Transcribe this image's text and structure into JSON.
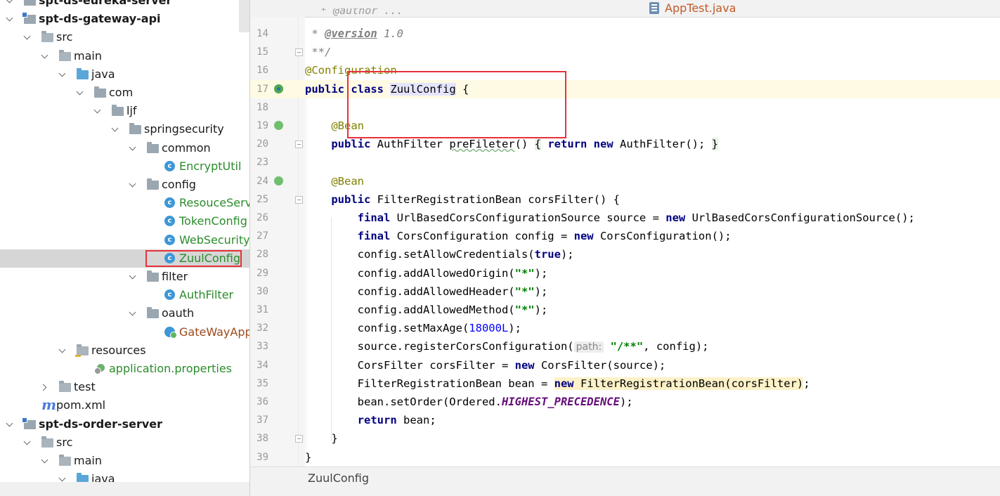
{
  "project_tree": {
    "rows": [
      {
        "label": "spt-ds-eureka-server",
        "depth": 0,
        "expanded": true,
        "icon": "module-icon",
        "style": "bold"
      },
      {
        "label": "spt-ds-gateway-api",
        "depth": 0,
        "expanded": true,
        "icon": "module-icon",
        "style": "bold"
      },
      {
        "label": "src",
        "depth": 1,
        "expanded": true,
        "icon": "folder-icon",
        "style": "plain"
      },
      {
        "label": "main",
        "depth": 2,
        "expanded": true,
        "icon": "folder-icon",
        "style": "plain"
      },
      {
        "label": "java",
        "depth": 3,
        "expanded": true,
        "icon": "source-folder-icon",
        "style": "plain"
      },
      {
        "label": "com",
        "depth": 4,
        "expanded": true,
        "icon": "package-icon",
        "style": "plain"
      },
      {
        "label": "ljf",
        "depth": 5,
        "expanded": true,
        "icon": "package-icon",
        "style": "plain"
      },
      {
        "label": "springsecurity",
        "depth": 6,
        "expanded": true,
        "icon": "package-icon",
        "style": "plain"
      },
      {
        "label": "common",
        "depth": 7,
        "expanded": true,
        "icon": "package-icon",
        "style": "plain"
      },
      {
        "label": "EncryptUtil",
        "depth": 8,
        "icon": "class-icon",
        "style": "green"
      },
      {
        "label": "config",
        "depth": 7,
        "expanded": true,
        "icon": "package-icon",
        "style": "plain"
      },
      {
        "label": "ResouceServer",
        "depth": 8,
        "icon": "class-icon",
        "style": "green"
      },
      {
        "label": "TokenConfig",
        "depth": 8,
        "icon": "class-icon",
        "style": "green"
      },
      {
        "label": "WebSecurityC",
        "depth": 8,
        "icon": "class-icon",
        "style": "green"
      },
      {
        "label": "ZuulConfig",
        "depth": 8,
        "icon": "class-icon",
        "style": "green",
        "selected": true
      },
      {
        "label": "filter",
        "depth": 7,
        "expanded": true,
        "icon": "package-icon",
        "style": "plain"
      },
      {
        "label": "AuthFilter",
        "depth": 8,
        "icon": "class-icon",
        "style": "green"
      },
      {
        "label": "oauth",
        "depth": 7,
        "expanded": true,
        "icon": "package-icon",
        "style": "plain"
      },
      {
        "label": "GateWayApp",
        "depth": 8,
        "icon": "spring-app-icon",
        "style": "brown"
      },
      {
        "label": "resources",
        "depth": 3,
        "expanded": true,
        "icon": "resources-folder-icon",
        "style": "plain"
      },
      {
        "label": "application.properties",
        "depth": 4,
        "icon": "properties-icon",
        "style": "green"
      },
      {
        "label": "test",
        "depth": 2,
        "expanded": false,
        "icon": "folder-icon",
        "style": "plain"
      },
      {
        "label": "pom.xml",
        "depth": 1,
        "icon": "maven-icon",
        "style": "plain"
      },
      {
        "label": "spt-ds-order-server",
        "depth": 0,
        "expanded": true,
        "icon": "module-icon",
        "style": "bold"
      },
      {
        "label": "src",
        "depth": 1,
        "expanded": true,
        "icon": "folder-icon",
        "style": "plain"
      },
      {
        "label": "main",
        "depth": 2,
        "expanded": true,
        "icon": "folder-icon",
        "style": "plain"
      },
      {
        "label": "java",
        "depth": 3,
        "expanded": true,
        "icon": "source-folder-icon",
        "style": "plain"
      }
    ]
  },
  "editor": {
    "tab_title": "AppTest.java",
    "status_breadcrumb": "ZuulConfig",
    "top_partial_text": "* @author ...",
    "lines": [
      {
        "n": "14",
        "tokens": [
          {
            "t": " * ",
            "c": "doc"
          },
          {
            "t": "@version",
            "c": "doctag"
          },
          {
            "t": " 1.0",
            "c": "doc"
          }
        ]
      },
      {
        "n": "15",
        "fold": true,
        "tokens": [
          {
            "t": " **/",
            "c": "doc"
          }
        ]
      },
      {
        "n": "16",
        "tokens": [
          {
            "t": "@Configuration",
            "c": "ann"
          }
        ]
      },
      {
        "n": "17",
        "current": true,
        "gutter": "impl",
        "tokens": [
          {
            "t": "public",
            "c": "kw"
          },
          {
            "t": " "
          },
          {
            "t": "class",
            "c": "kw"
          },
          {
            "t": " "
          },
          {
            "t": "ZuulConfig",
            "c": "sel"
          },
          {
            "t": " {"
          }
        ]
      },
      {
        "n": "18",
        "tokens": []
      },
      {
        "n": "19",
        "gutter": "bean",
        "tokens": [
          {
            "t": "    "
          },
          {
            "t": "@Bean",
            "c": "ann"
          }
        ]
      },
      {
        "n": "20",
        "fold": true,
        "tokens": [
          {
            "t": "    "
          },
          {
            "t": "public",
            "c": "kw"
          },
          {
            "t": " AuthFilter "
          },
          {
            "t": "preFileter",
            "c": "wavy"
          },
          {
            "t": "() "
          },
          {
            "t": "{",
            "c": "brace"
          },
          {
            "t": " "
          },
          {
            "t": "return",
            "c": "kw"
          },
          {
            "t": " "
          },
          {
            "t": "new",
            "c": "kw"
          },
          {
            "t": " AuthFilter(); "
          },
          {
            "t": "}",
            "c": "brace"
          }
        ]
      },
      {
        "n": "23",
        "tokens": []
      },
      {
        "n": "24",
        "gutter": "bean",
        "tokens": [
          {
            "t": "    "
          },
          {
            "t": "@Bean",
            "c": "ann"
          }
        ]
      },
      {
        "n": "25",
        "fold": true,
        "tokens": [
          {
            "t": "    "
          },
          {
            "t": "public",
            "c": "kw"
          },
          {
            "t": " FilterRegistrationBean corsFilter() {"
          }
        ]
      },
      {
        "n": "26",
        "tokens": [
          {
            "t": "        "
          },
          {
            "t": "final",
            "c": "kw"
          },
          {
            "t": " UrlBasedCorsConfigurationSource source = "
          },
          {
            "t": "new",
            "c": "kw"
          },
          {
            "t": " UrlBasedCorsConfigurationSource();"
          }
        ]
      },
      {
        "n": "27",
        "tokens": [
          {
            "t": "        "
          },
          {
            "t": "final",
            "c": "kw"
          },
          {
            "t": " CorsConfiguration config = "
          },
          {
            "t": "new",
            "c": "kw"
          },
          {
            "t": " CorsConfiguration();"
          }
        ]
      },
      {
        "n": "28",
        "tokens": [
          {
            "t": "        config.setAllowCredentials("
          },
          {
            "t": "true",
            "c": "kw"
          },
          {
            "t": ");"
          }
        ]
      },
      {
        "n": "29",
        "tokens": [
          {
            "t": "        config.addAllowedOrigin("
          },
          {
            "t": "\"*\"",
            "c": "str"
          },
          {
            "t": ");"
          }
        ]
      },
      {
        "n": "30",
        "tokens": [
          {
            "t": "        config.addAllowedHeader("
          },
          {
            "t": "\"*\"",
            "c": "str"
          },
          {
            "t": ");"
          }
        ]
      },
      {
        "n": "31",
        "tokens": [
          {
            "t": "        config.addAllowedMethod("
          },
          {
            "t": "\"*\"",
            "c": "str"
          },
          {
            "t": ");"
          }
        ]
      },
      {
        "n": "32",
        "tokens": [
          {
            "t": "        config.setMaxAge("
          },
          {
            "t": "18000L",
            "c": "num"
          },
          {
            "t": ");"
          }
        ]
      },
      {
        "n": "33",
        "tokens": [
          {
            "t": "        source.registerCorsConfiguration("
          },
          {
            "t": "path:",
            "c": "hint"
          },
          {
            "t": " "
          },
          {
            "t": "\"/**\"",
            "c": "str"
          },
          {
            "t": ", config);"
          }
        ]
      },
      {
        "n": "34",
        "tokens": [
          {
            "t": "        CorsFilter corsFilter = "
          },
          {
            "t": "new",
            "c": "kw"
          },
          {
            "t": " CorsFilter(source);"
          }
        ]
      },
      {
        "n": "35",
        "tokens": [
          {
            "t": "        FilterRegistrationBean bean = "
          },
          {
            "t": "new",
            "c": "kw hl"
          },
          {
            "t": " FilterRegistrationBean(corsFilter)",
            "c": "hl"
          },
          {
            "t": ";"
          }
        ]
      },
      {
        "n": "36",
        "tokens": [
          {
            "t": "        bean.setOrder(Ordered."
          },
          {
            "t": "HIGHEST_PRECEDENCE",
            "c": "const"
          },
          {
            "t": ");"
          }
        ]
      },
      {
        "n": "37",
        "tokens": [
          {
            "t": "        "
          },
          {
            "t": "return",
            "c": "kw"
          },
          {
            "t": " bean;"
          }
        ]
      },
      {
        "n": "38",
        "fold": true,
        "tokens": [
          {
            "t": "    }"
          }
        ]
      },
      {
        "n": "39",
        "tokens": [
          {
            "t": "}"
          }
        ]
      }
    ]
  },
  "colors": {
    "annotation_red": "#e8313a",
    "keyword": "#000080",
    "annotation": "#808000",
    "string": "#008000",
    "selected_row": "#d6d6d6",
    "current_line": "#fffae3"
  }
}
